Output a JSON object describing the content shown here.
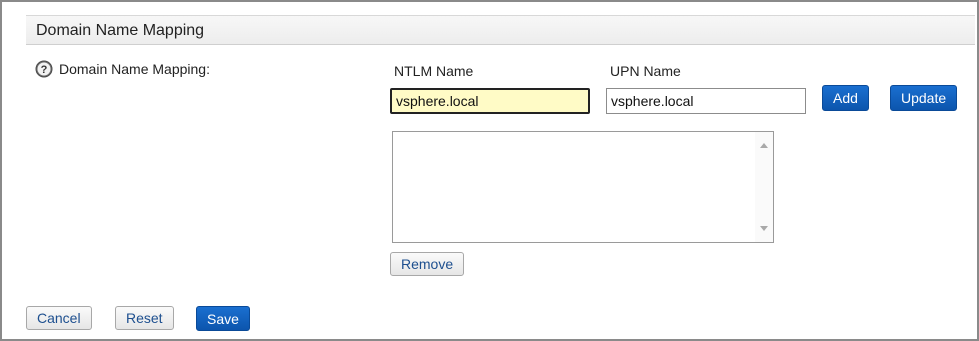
{
  "section": {
    "title": "Domain Name Mapping"
  },
  "field": {
    "label": "Domain Name Mapping:"
  },
  "columns": {
    "ntlm_header": "NTLM Name",
    "upn_header": "UPN Name"
  },
  "inputs": {
    "ntlm_value": "vsphere.local",
    "upn_value": "vsphere.local"
  },
  "buttons": {
    "add": "Add",
    "update": "Update",
    "remove": "Remove",
    "cancel": "Cancel",
    "reset": "Reset",
    "save": "Save"
  },
  "mapping_list": {
    "items": []
  },
  "icons": {
    "help": "help-icon",
    "scroll_up": "chevron-up-icon",
    "scroll_down": "chevron-down-icon"
  },
  "colors": {
    "primary_button": "#0c55ad",
    "focused_input_bg": "#fffbc6",
    "secondary_text": "#1d4f8f"
  }
}
